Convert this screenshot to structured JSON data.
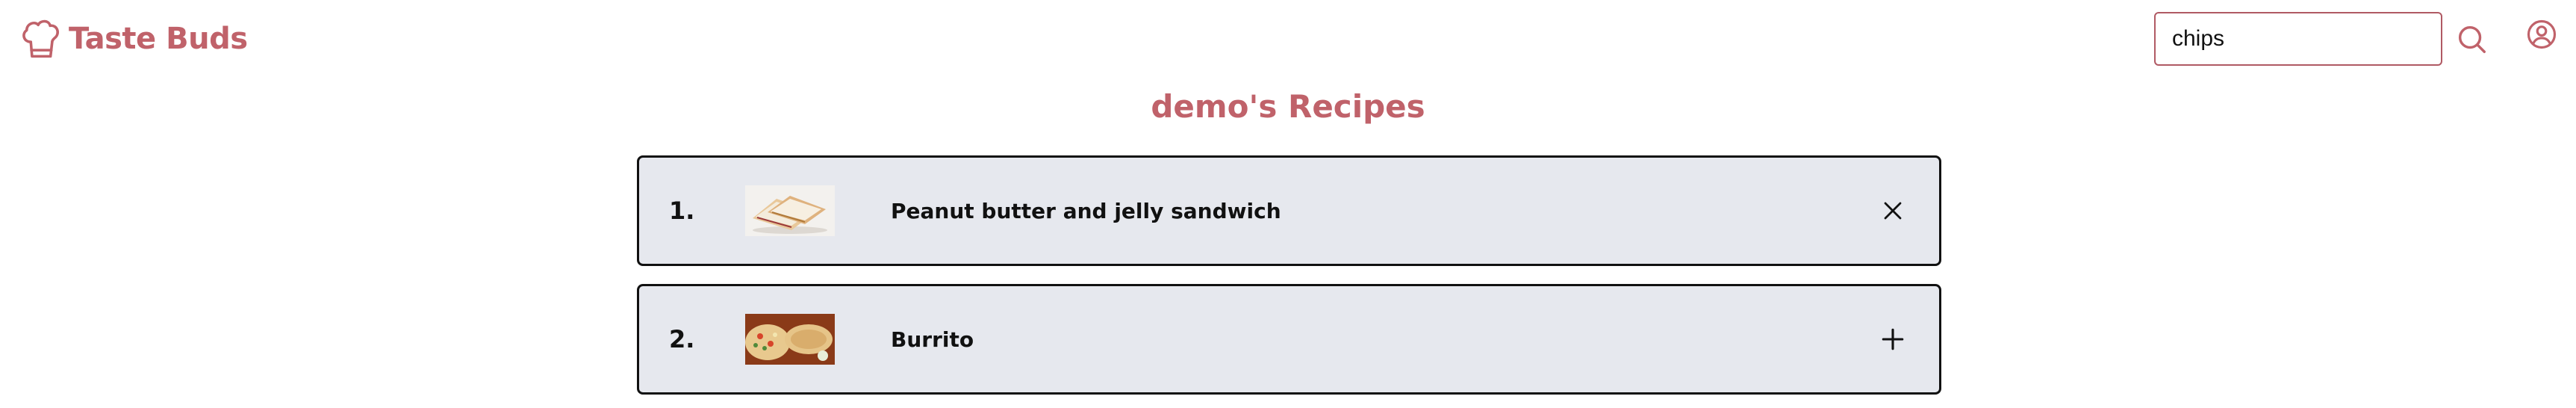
{
  "header": {
    "logo_text": "Taste Buds",
    "logo_icon": "chef-hat-icon",
    "search": {
      "value": "chips",
      "placeholder": ""
    },
    "search_icon": "search-icon",
    "profile_icon": "user-circle-icon"
  },
  "page": {
    "title": "demo's Recipes"
  },
  "recipes": [
    {
      "number": "1.",
      "name": "Peanut butter and jelly sandwich",
      "action": "remove",
      "action_icon": "close-icon"
    },
    {
      "number": "2.",
      "name": "Burrito",
      "action": "add",
      "action_icon": "plus-icon"
    }
  ],
  "colors": {
    "brand": "#c0626a",
    "row_background": "#e6e8ee",
    "row_border": "#111111"
  }
}
